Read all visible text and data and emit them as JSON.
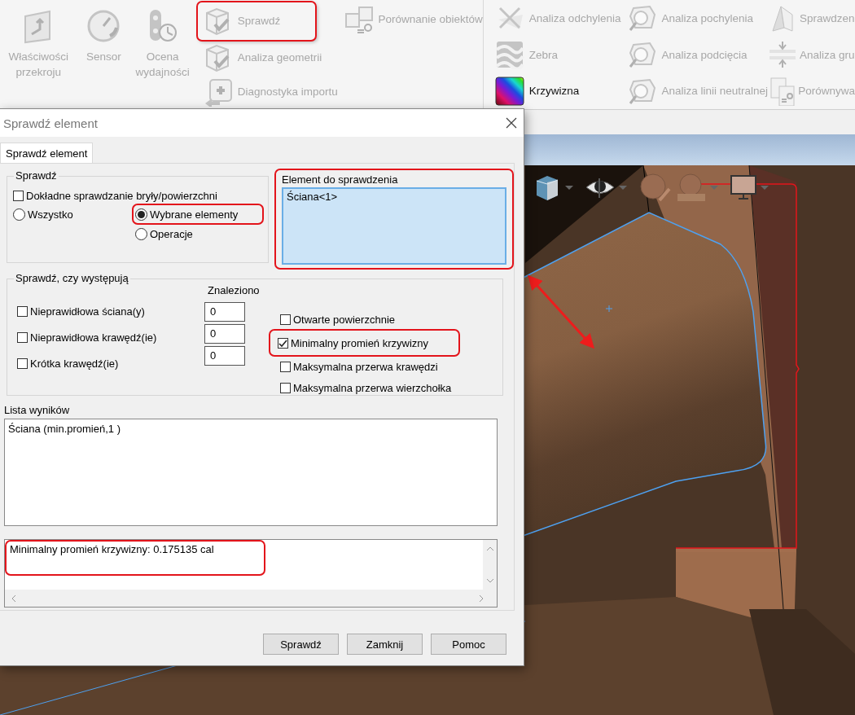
{
  "ribbon": {
    "large_buttons": [
      {
        "label": "Właściwości przekroju",
        "disabled": true
      },
      {
        "label": "Sensor",
        "disabled": true
      },
      {
        "label": "Ocena wydajności",
        "disabled": true
      }
    ],
    "columns": [
      [
        {
          "label": "Sprawdź",
          "disabled": true,
          "annotated": true
        },
        {
          "label": "Analiza geometrii",
          "disabled": true,
          "annotated": false
        },
        {
          "label": "Diagnostyka importu",
          "disabled": true,
          "annotated": false
        }
      ],
      [
        {
          "label": "Porównanie obiektów",
          "disabled": true,
          "annotated": false
        }
      ],
      [
        {
          "label": "Analiza odchylenia",
          "disabled": true,
          "annotated": false
        },
        {
          "label": "Zebra",
          "disabled": true,
          "annotated": false
        },
        {
          "label": "Krzywizna",
          "disabled": false,
          "annotated": false
        }
      ],
      [
        {
          "label": "Analiza pochylenia",
          "disabled": true,
          "annotated": false
        },
        {
          "label": "Analiza podcięcia",
          "disabled": true,
          "annotated": false
        },
        {
          "label": "Analiza linii neutralnej",
          "disabled": true,
          "annotated": false
        }
      ],
      [
        {
          "label": "Sprawdzen",
          "disabled": true,
          "annotated": false
        },
        {
          "label": "Analiza gru",
          "disabled": true,
          "annotated": false
        },
        {
          "label": "Porównywa",
          "disabled": true,
          "annotated": false
        }
      ]
    ]
  },
  "dialog": {
    "title": "Sprawdź element",
    "tabs": [
      {
        "label": "Sprawdź element",
        "selected": true
      }
    ],
    "check_group": {
      "title": "Sprawdź",
      "precise": {
        "label": "Dokładne sprawdzanie bryły/powierzchni",
        "checked": false
      },
      "scope_options": [
        {
          "label": "Wszystko",
          "selected": false,
          "annotated": false
        },
        {
          "label": "Wybrane elementy",
          "selected": true,
          "annotated": true
        },
        {
          "label": "Operacje",
          "selected": false,
          "annotated": false
        }
      ]
    },
    "selection": {
      "label": "Element do sprawdzenia",
      "items": [
        "Ściana<1>"
      ],
      "annotated": true
    },
    "occurrence_group": {
      "title": "Sprawdź, czy występują",
      "found_header": "Znaleziono",
      "counted_checks": [
        {
          "label": "Nieprawidłowa ściana(y)",
          "checked": false,
          "count": "0"
        },
        {
          "label": "Nieprawidłowa krawędź(ie)",
          "checked": false,
          "count": "0"
        },
        {
          "label": "Krótka krawędź(ie)",
          "checked": false,
          "count": "0"
        }
      ],
      "other_checks": [
        {
          "label": "Otwarte powierzchnie",
          "checked": false,
          "annotated": false
        },
        {
          "label": "Minimalny promień krzywizny",
          "checked": true,
          "annotated": true
        },
        {
          "label": "Maksymalna przerwa krawędzi",
          "checked": false,
          "annotated": false
        },
        {
          "label": "Maksymalna przerwa wierzchołka",
          "checked": false,
          "annotated": false
        }
      ]
    },
    "results": {
      "label": "Lista wyników",
      "items": [
        "Ściana (min.promień,1  )"
      ]
    },
    "output": {
      "lines": [
        "Minimalny promień krzywizny: 0.175135 cal"
      ],
      "annotated": true
    },
    "buttons": [
      "Sprawdź",
      "Zamknij",
      "Pomoc"
    ]
  }
}
